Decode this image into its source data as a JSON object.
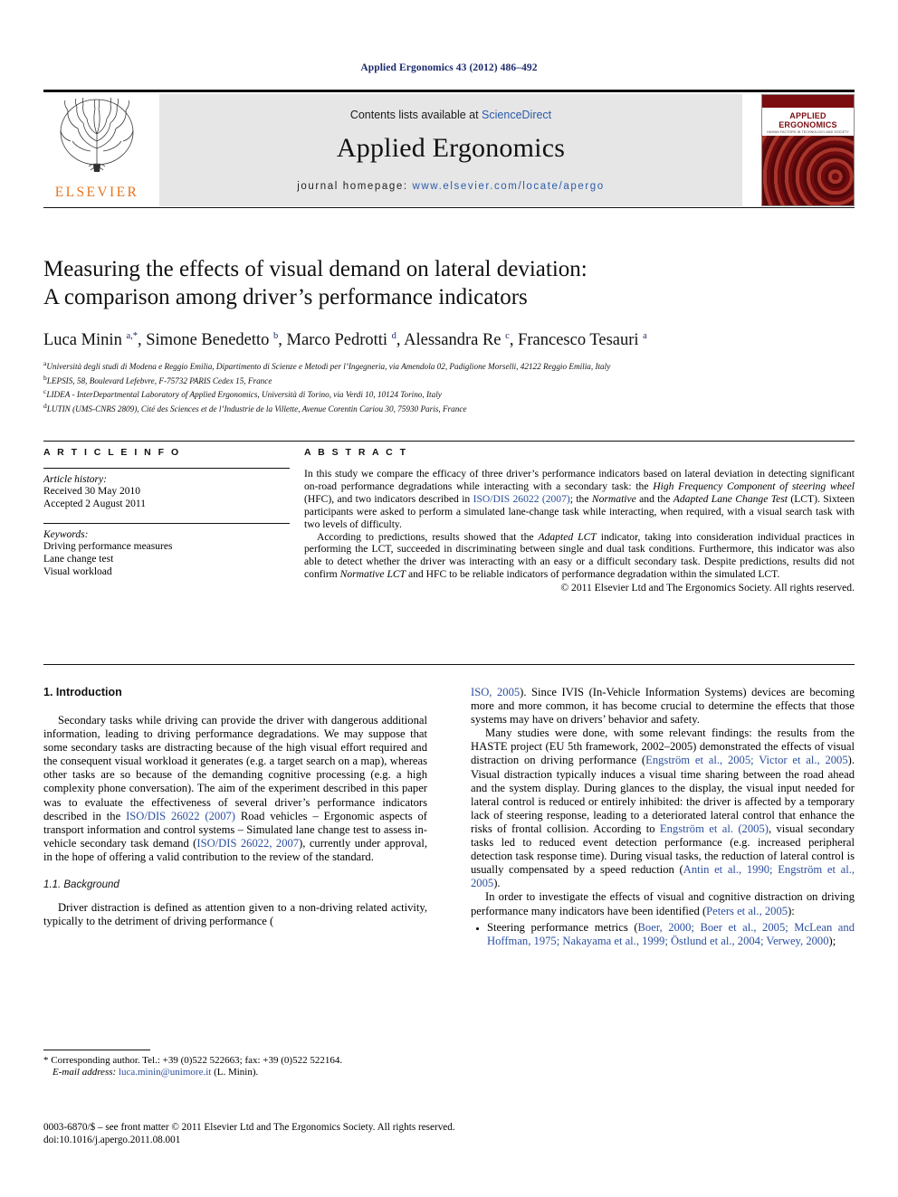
{
  "running_head": "Applied Ergonomics 43 (2012) 486–492",
  "masthead": {
    "publisher_name": "ELSEVIER",
    "contents_prefix": "Contents lists available at ",
    "sciencedirect": "ScienceDirect",
    "journal_name": "Applied Ergonomics",
    "homepage_prefix": "journal homepage: ",
    "homepage_url": "www.elsevier.com/locate/apergo",
    "cover": {
      "title": "APPLIED ERGONOMICS",
      "subtitle": "HUMAN FACTORS IN TECHNOLOGY AND SOCIETY"
    }
  },
  "title": {
    "line1": "Measuring the effects of visual demand on lateral deviation:",
    "line2": "A comparison among driver’s performance indicators"
  },
  "authors_html": "Luca Minin <sup>a,*</sup>, Simone Benedetto <sup>b</sup>, Marco Pedrotti <sup>d</sup>, Alessandra Re <sup>c</sup>, Francesco Tesauri <sup>a</sup>",
  "affiliations": [
    "Università degli studi di Modena e Reggio Emilia, Dipartimento di Scienze e Metodi per l’Ingegneria, via Amendola 02, Padiglione Morselli, 42122 Reggio Emilia, Italy",
    "LEPSIS, 58, Boulevard Lefebvre, F-75732 PARIS Cedex 15, France",
    "LIDEA - InterDepartmental Laboratory of Applied Ergonomics, Università di Torino, via Verdi 10, 10124 Torino, Italy",
    "LUTIN (UMS-CNRS 2809), Cité des Sciences et de l’Industrie de la Villette, Avenue Corentin Cariou 30, 75930 Paris, France"
  ],
  "affiliation_markers": [
    "a",
    "b",
    "c",
    "d"
  ],
  "article_info": {
    "heading": "A R T I C L E   I N F O",
    "history_label": "Article history:",
    "received": "Received 30 May 2010",
    "accepted": "Accepted 2 August 2011",
    "keywords_label": "Keywords:",
    "keywords": [
      "Driving performance measures",
      "Lane change test",
      "Visual workload"
    ]
  },
  "abstract": {
    "heading": "A B S T R A C T",
    "p1_a": "In this study we compare the efficacy of three driver’s performance indicators based on lateral deviation in detecting significant on-road performance degradations while interacting with a secondary task: the ",
    "p1_i1": "High Frequency Component of steering wheel",
    "p1_b": " (HFC), and two indicators described in ",
    "p1_ref1": "ISO/DIS 26022 (2007)",
    "p1_c": "; the ",
    "p1_i2": "Normative",
    "p1_d": " and the ",
    "p1_i3": "Adapted Lane Change Test",
    "p1_e": " (LCT). Sixteen participants were asked to perform a simulated lane-change task while interacting, when required, with a visual search task with two levels of difficulty.",
    "p2_a": "According to predictions, results showed that the ",
    "p2_i1": "Adapted LCT",
    "p2_b": " indicator, taking into consideration individual practices in performing the LCT, succeeded in discriminating between single and dual task conditions. Furthermore, this indicator was also able to detect whether the driver was interacting with an easy or a difficult secondary task. Despite predictions, results did not confirm ",
    "p2_i2": "Normative LCT",
    "p2_c": " and HFC to be reliable indicators of performance degradation within the simulated LCT.",
    "copyright": "© 2011 Elsevier Ltd and The Ergonomics Society. All rights reserved."
  },
  "body": {
    "section1_heading": "1. Introduction",
    "intro_p1_a": "Secondary tasks while driving can provide the driver with dangerous additional information, leading to driving performance degradations. We may suppose that some secondary tasks are distracting because of the high visual effort required and the consequent visual workload it generates (e.g. a target search on a map), whereas other tasks are so because of the demanding cognitive processing (e.g. a high complexity phone conversation). The aim of the experiment described in this paper was to evaluate the effectiveness of several driver’s performance indicators described in the ",
    "intro_p1_ref1": "ISO/DIS 26022 (2007)",
    "intro_p1_b": " Road vehicles – Ergonomic aspects of transport information and control systems – Simulated lane change test to assess in-vehicle secondary task demand (",
    "intro_p1_ref2": "ISO/DIS 26022, 2007",
    "intro_p1_c": "), currently under approval, in the hope of offering a valid contribution to the review of the standard.",
    "subsection11_heading": "1.1. Background",
    "bg_p1_a": "Driver distraction is defined as attention given to a non-driving related activity, typically to the detriment of driving performance (",
    "bg_p1_ref1": "ISO, 2005",
    "bg_p1_b": "). Since IVIS (In-Vehicle Information Systems) devices are becoming more and more common, it has become crucial to determine the effects that those systems may have on drivers’ behavior and safety.",
    "bg_p2_a": "Many studies were done, with some relevant findings: the results from the HASTE project (EU 5th framework, 2002–2005) demonstrated the effects of visual distraction on driving performance (",
    "bg_p2_ref1": "Engström et al., 2005; Victor et al., 2005",
    "bg_p2_b": "). Visual distraction typically induces a visual time sharing between the road ahead and the system display. During glances to the display, the visual input needed for lateral control is reduced or entirely inhibited: the driver is affected by a temporary lack of steering response, leading to a deteriorated lateral control that enhance the risks of frontal collision. According to ",
    "bg_p2_ref2": "Engström et al. (2005)",
    "bg_p2_c": ", visual secondary tasks led to reduced event detection performance (e.g. increased peripheral detection task response time). During visual tasks, the reduction of lateral control is usually compensated by a speed reduction (",
    "bg_p2_ref3": "Antin et al., 1990; Engström et al., 2005",
    "bg_p2_d": ").",
    "bg_p3_a": "In order to investigate the effects of visual and cognitive distraction on driving performance many indicators have been identified (",
    "bg_p3_ref1": "Peters et al., 2005",
    "bg_p3_b": "):",
    "bullet1_a": "Steering performance metrics (",
    "bullet1_ref": "Boer, 2000; Boer et al., 2005; McLean and Hoffman, 1975; Nakayama et al., 1999; Östlund et al., 2004; Verwey, 2000",
    "bullet1_b": ");"
  },
  "footnote": {
    "corresponding": "* Corresponding author. Tel.: +39 (0)522 522663; fax: +39 (0)522 522164.",
    "email_label": "E-mail address:",
    "email": "luca.minin@unimore.it",
    "email_owner": "(L. Minin)."
  },
  "bottom": {
    "issn_line_a": "0003-6870/$ – see front matter © 2011 Elsevier Ltd and The Ergonomics Society. All rights reserved.",
    "doi_line": "doi:10.1016/j.apergo.2011.08.001"
  },
  "colors": {
    "link": "#2b4f9e",
    "running_head": "#1b2a6b",
    "elsevier_orange": "#e8741e",
    "band_gray": "#e6e6e6",
    "cover_red": "#7b0c10"
  }
}
